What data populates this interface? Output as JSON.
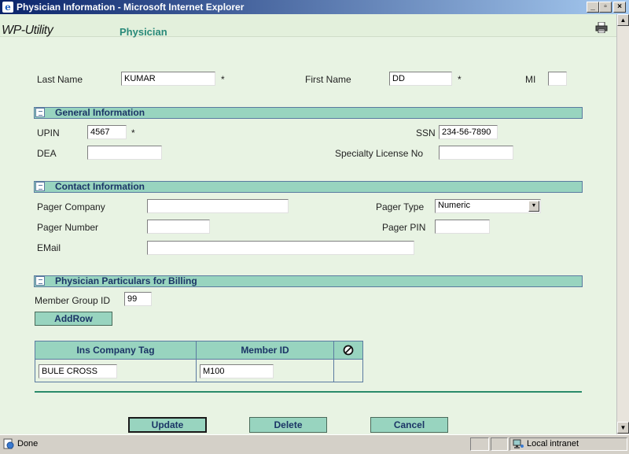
{
  "window": {
    "title": "Physician Information - Microsoft Internet Explorer",
    "minimize": "_",
    "maximize": "▫",
    "close": "×"
  },
  "header": {
    "logo": "WP-Utility",
    "page_title": "Physician"
  },
  "name_row": {
    "last_name_label": "Last Name",
    "last_name_value": "KUMAR",
    "first_name_label": "First Name",
    "first_name_value": "DD",
    "mi_label": "MI",
    "mi_value": "",
    "required_mark": "*"
  },
  "general": {
    "title": "General Information",
    "upin_label": "UPIN",
    "upin_value": "4567",
    "ssn_label": "SSN",
    "ssn_value": "234-56-7890",
    "dea_label": "DEA",
    "dea_value": "",
    "license_label": "Specialty License No",
    "license_value": ""
  },
  "contact": {
    "title": "Contact Information",
    "pager_company_label": "Pager Company",
    "pager_company_value": "",
    "pager_type_label": "Pager Type",
    "pager_type_value": "Numeric",
    "pager_number_label": "Pager Number",
    "pager_number_value": "",
    "pager_pin_label": "Pager PIN",
    "pager_pin_value": "",
    "email_label": "EMail",
    "email_value": ""
  },
  "billing": {
    "title": "Physician Particulars for Billing",
    "member_group_label": "Member Group ID",
    "member_group_value": "99",
    "add_row_label": "AddRow",
    "columns": [
      "Ins Company Tag",
      "Member ID"
    ],
    "rows": [
      {
        "ins_company_tag": "BULE CROSS",
        "member_id": "M100"
      }
    ]
  },
  "actions": {
    "update": "Update",
    "delete": "Delete",
    "cancel": "Cancel"
  },
  "status": {
    "text": "Done",
    "zone": "Local intranet"
  },
  "colors": {
    "page_bg": "#e8f3e3",
    "section_bg": "#98d4bf",
    "section_text": "#1b3566",
    "accent": "#2a8a7a"
  }
}
